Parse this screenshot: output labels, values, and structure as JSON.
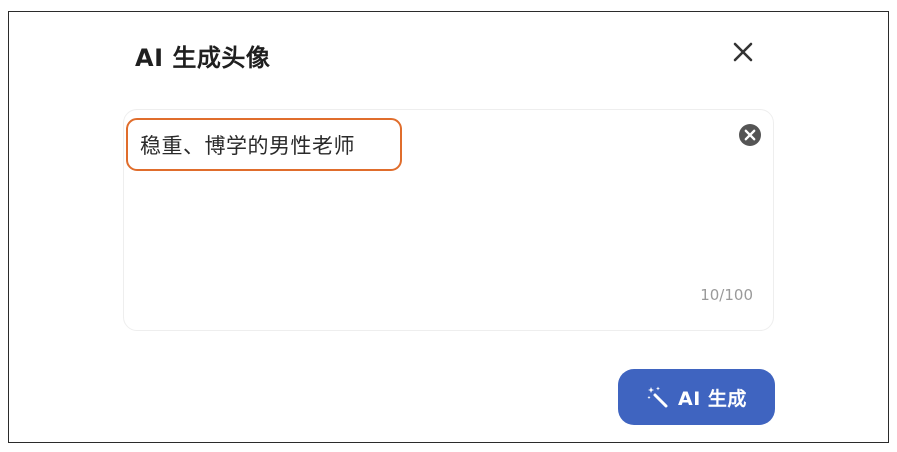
{
  "dialog": {
    "title": "AI 生成头像",
    "close_icon": "close-icon"
  },
  "prompt": {
    "value": "稳重、博学的男性老师",
    "char_count": "10/100",
    "clear_icon": "clear-circle-x-icon",
    "highlight_color": "#e06d2c"
  },
  "actions": {
    "generate_label": "AI 生成",
    "generate_icon": "magic-wand-icon",
    "button_color": "#3f64c0"
  }
}
